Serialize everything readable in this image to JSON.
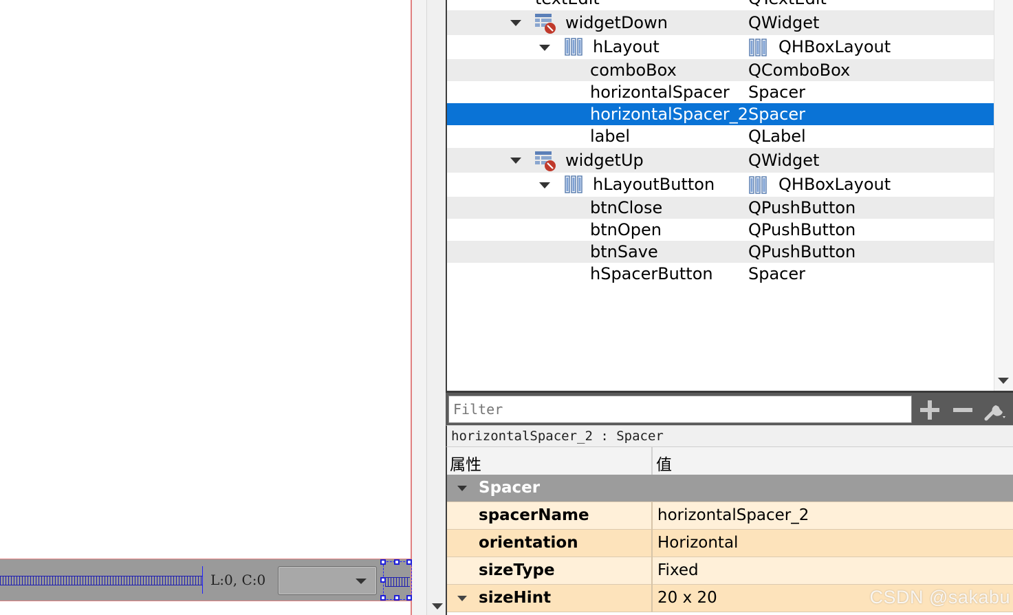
{
  "canvas": {
    "position_label": "L:0, C:0",
    "combo_value": ""
  },
  "tree": {
    "rows": [
      {
        "name": "textEdit",
        "cls": "QTextEdit",
        "icon": "",
        "indent": 2
      },
      {
        "name": "widgetDown",
        "cls": "QWidget",
        "icon": "widget-icon",
        "expanded": true
      },
      {
        "name": "hLayout",
        "cls": "QHBoxLayout",
        "icon": "hbox-layout-icon",
        "expanded": true
      },
      {
        "name": "comboBox",
        "cls": "QComboBox"
      },
      {
        "name": "horizontalSpacer",
        "cls": "Spacer"
      },
      {
        "name": "horizontalSpacer_2",
        "cls": "Spacer",
        "selected": true
      },
      {
        "name": "label",
        "cls": "QLabel"
      },
      {
        "name": "widgetUp",
        "cls": "QWidget",
        "icon": "widget-icon",
        "expanded": true
      },
      {
        "name": "hLayoutButton",
        "cls": "QHBoxLayout",
        "icon": "hbox-layout-icon",
        "expanded": true
      },
      {
        "name": "btnClose",
        "cls": "QPushButton"
      },
      {
        "name": "btnOpen",
        "cls": "QPushButton"
      },
      {
        "name": "btnSave",
        "cls": "QPushButton"
      },
      {
        "name": "hSpacerButton",
        "cls": "Spacer"
      }
    ]
  },
  "filter": {
    "placeholder": "Filter",
    "add_icon": "plus-icon",
    "remove_icon": "minus-icon",
    "config_icon": "wrench-icon"
  },
  "selected_object": "horizontalSpacer_2 : Spacer",
  "properties": {
    "header_property": "属性",
    "header_value": "值",
    "group": "Spacer",
    "rows": [
      {
        "name": "spacerName",
        "value": "horizontalSpacer_2"
      },
      {
        "name": "orientation",
        "value": "Horizontal"
      },
      {
        "name": "sizeType",
        "value": "Fixed"
      },
      {
        "name": "sizeHint",
        "value": "20 x 20"
      }
    ]
  },
  "watermark": "CSDN @sakabu",
  "colors": {
    "selection": "#0a73d6",
    "property_light": "#fff0d9",
    "property_dark": "#fde3bb",
    "group_header": "#9c9c9c"
  }
}
